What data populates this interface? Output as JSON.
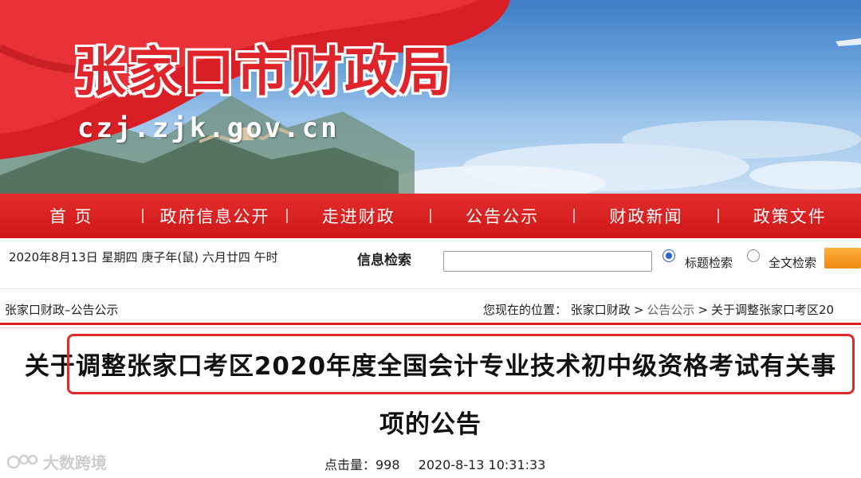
{
  "site": {
    "title": "张家口市财政局",
    "domain": "czj.zjk.gov.cn"
  },
  "nav": [
    {
      "label": "首 页"
    },
    {
      "label": "政府信息公开"
    },
    {
      "label": "走进财政"
    },
    {
      "label": "公告公示"
    },
    {
      "label": "财政新闻"
    },
    {
      "label": "政策文件"
    }
  ],
  "infobar": {
    "date": "2020年8月13日 星期四 庚子年(鼠) 六月廿四 午时",
    "search_label": "信息检索",
    "search_value": "",
    "radio_title": "标题检索",
    "radio_fulltext": "全文检索",
    "selected_radio": "标题检索"
  },
  "location": {
    "section_title": "张家口财政–公告公示",
    "prefix": "您现在的位置：",
    "crumbs": [
      "张家口财政",
      "公告公示",
      "关于调整张家口考区20"
    ]
  },
  "article": {
    "title_line1": "关于调整张家口考区2020年度全国会计专业技术初中级资格考试有关事",
    "title_line2": "项的公告",
    "hits": "点击量：998",
    "datetime": "2020-8-13 10:31:33"
  },
  "watermark": {
    "text": "大数跨境"
  },
  "colors": {
    "nav_red": "#d81e1e",
    "title_red": "#e0242c",
    "highlight": "#e02a2a",
    "radio_blue": "#2a62d4"
  }
}
